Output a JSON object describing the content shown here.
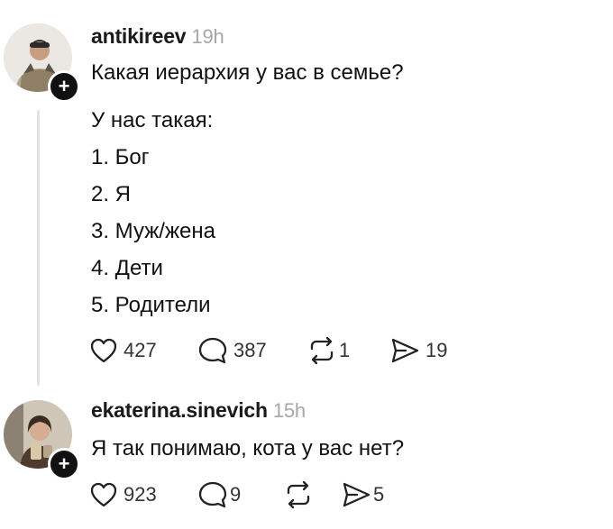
{
  "post": {
    "username": "antikireev",
    "time": "19h",
    "lines": [
      "Какая иерархия у вас в семье?",
      "У нас такая:",
      "1. Бог",
      "2. Я",
      "3. Муж/жена",
      "4. Дети",
      "5. Родители"
    ],
    "likes": "427",
    "replies": "387",
    "reposts": "1",
    "shares": "19"
  },
  "reply": {
    "username": "ekaterina.sinevich",
    "time": "15h",
    "text": "Я так понимаю, кота у вас нет?",
    "likes": "923",
    "replies": "9",
    "reposts": "",
    "shares": "5"
  },
  "icons": {
    "like": "heart-icon",
    "reply": "comment-bubble-icon",
    "repost": "repost-icon",
    "share": "send-icon",
    "follow": "plus-icon"
  }
}
